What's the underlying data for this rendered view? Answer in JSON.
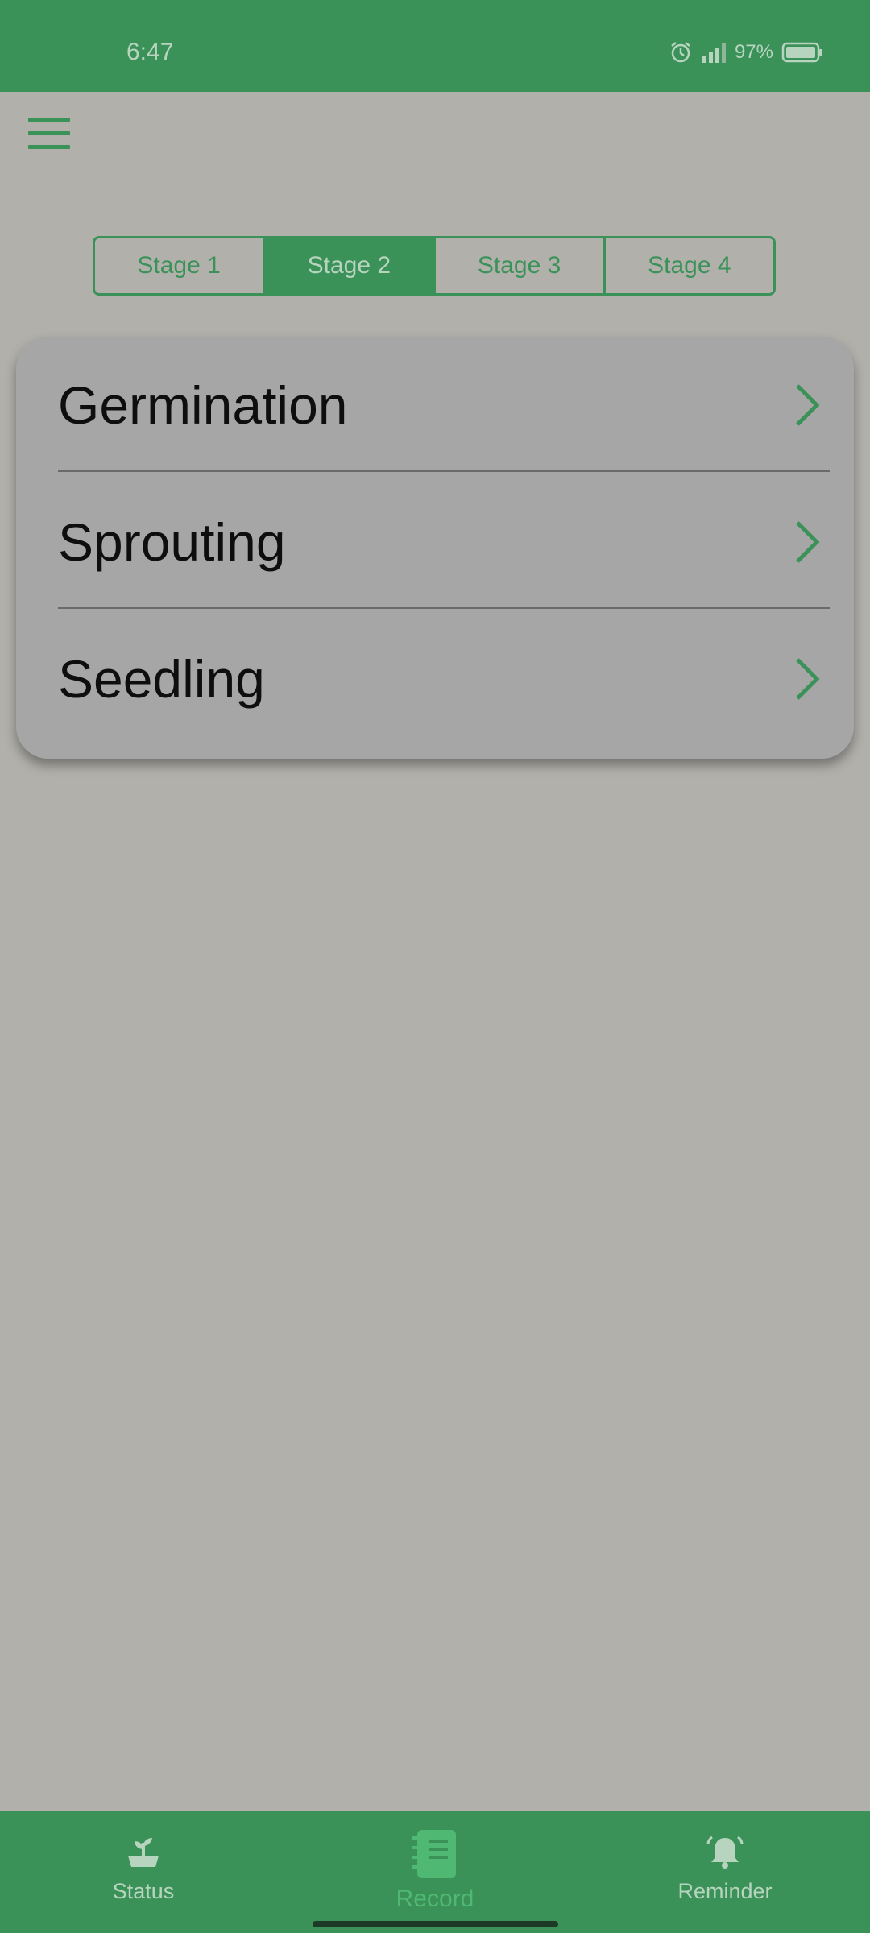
{
  "status_bar": {
    "time": "6:47",
    "battery": "97%",
    "icons": [
      "alarm-icon",
      "signal-icon",
      "battery-icon"
    ]
  },
  "header": {
    "menu_icon": "hamburger-menu-icon"
  },
  "stage_tabs": {
    "items": [
      {
        "label": "Stage 1",
        "active": false
      },
      {
        "label": "Stage 2",
        "active": true
      },
      {
        "label": "Stage 3",
        "active": false
      },
      {
        "label": "Stage 4",
        "active": false
      }
    ]
  },
  "stage_list": {
    "items": [
      {
        "label": "Germination",
        "icon": "chevron-right-icon"
      },
      {
        "label": "Sprouting",
        "icon": "chevron-right-icon"
      },
      {
        "label": "Seedling",
        "icon": "chevron-right-icon"
      }
    ]
  },
  "bottom_nav": {
    "items": [
      {
        "label": "Status",
        "icon": "plant-status-icon",
        "active": false
      },
      {
        "label": "Record",
        "icon": "notebook-icon",
        "active": true
      },
      {
        "label": "Reminder",
        "icon": "bell-icon",
        "active": false
      }
    ]
  },
  "colors": {
    "primary": "#3b9259",
    "background": "#b1b0ab",
    "card": "#a6a6a6",
    "active_nav": "#4fb872"
  }
}
